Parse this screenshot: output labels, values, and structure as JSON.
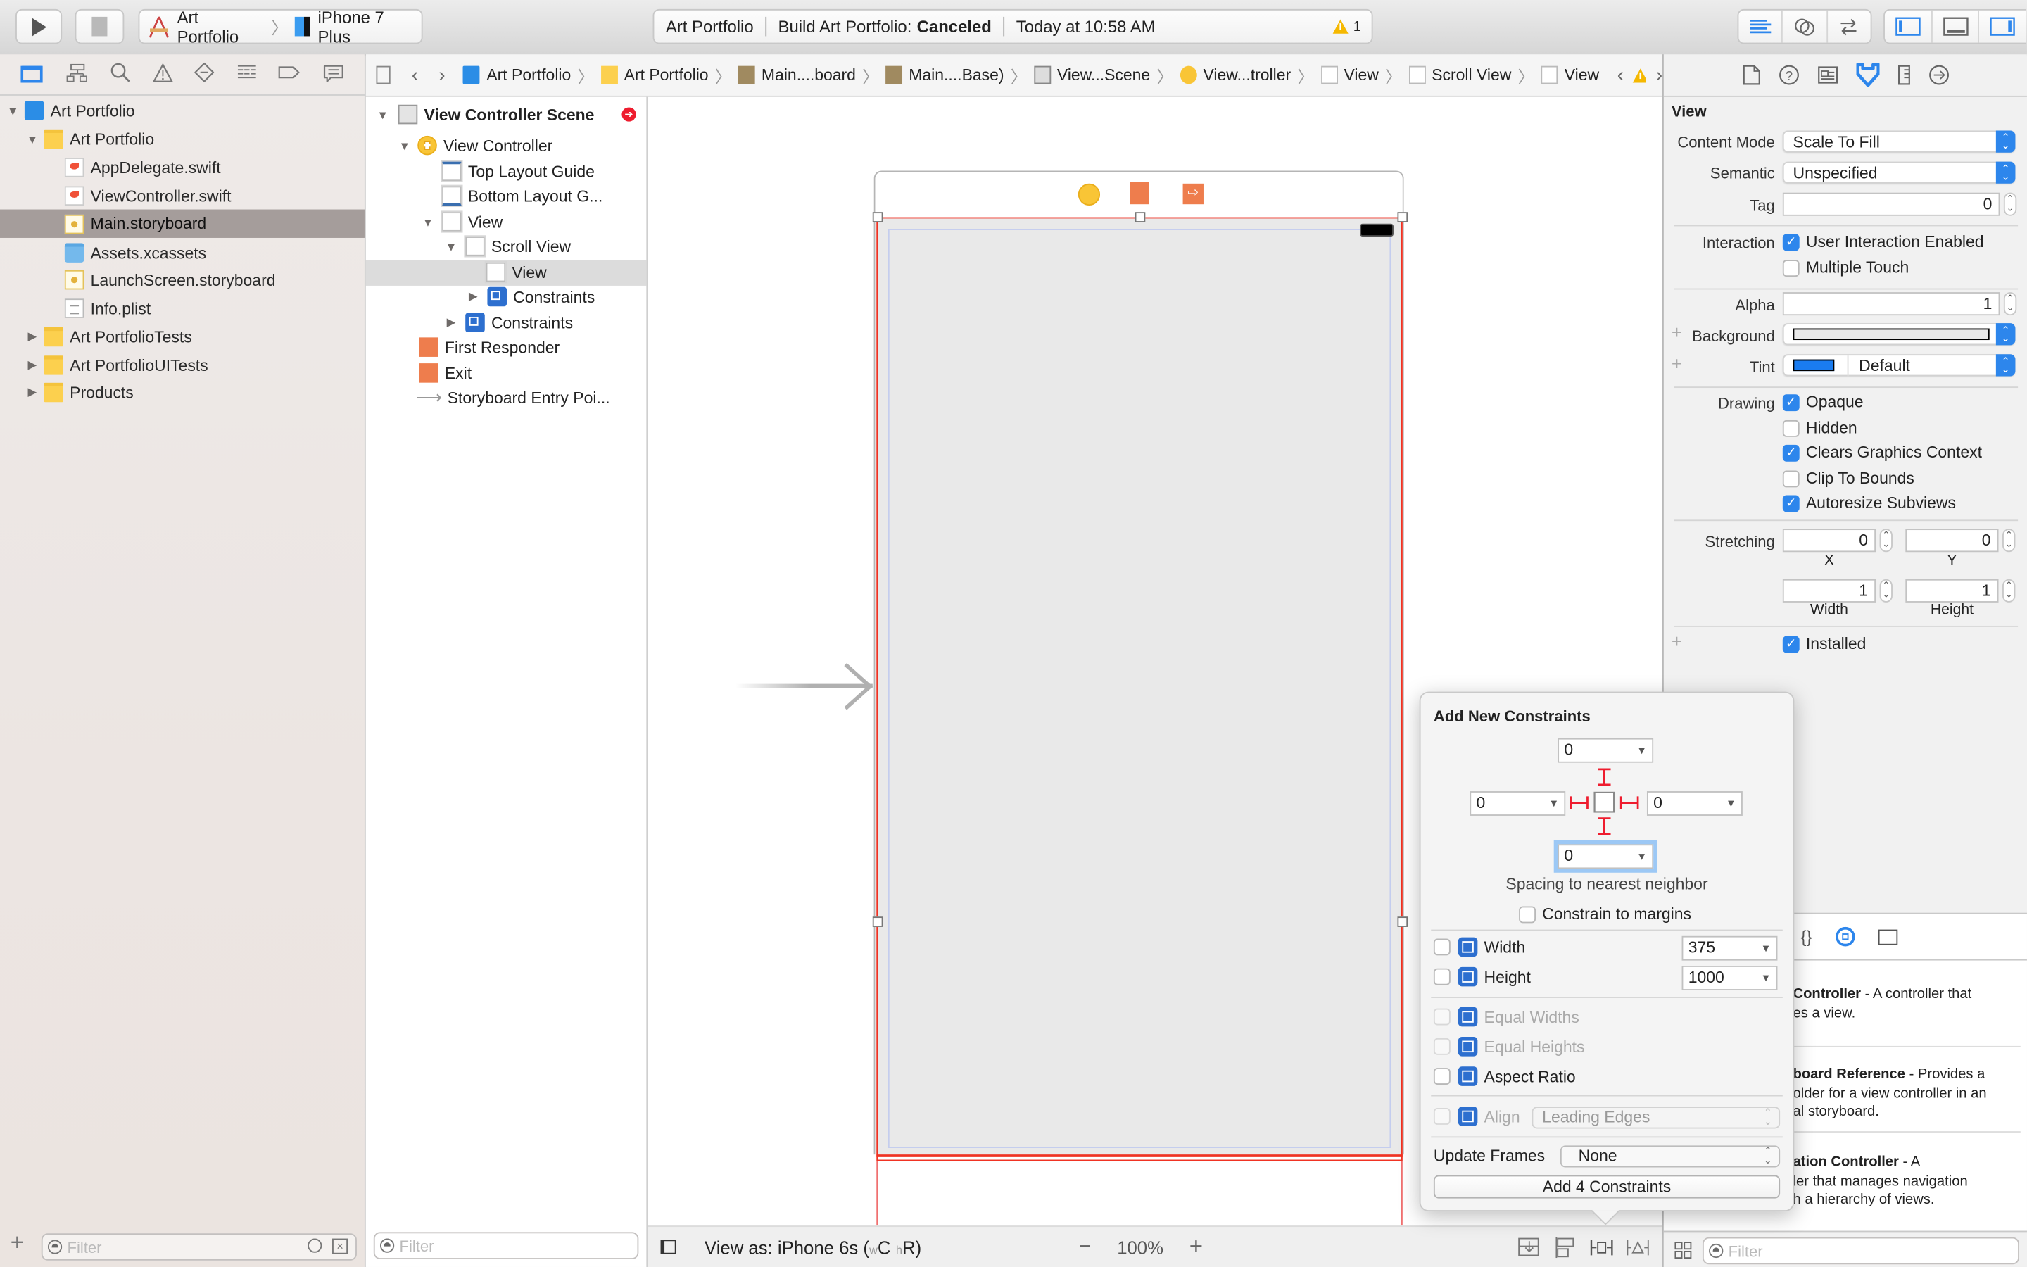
{
  "toolbar": {
    "scheme": "Art Portfolio",
    "device": "iPhone 7 Plus",
    "activity": {
      "project": "Art Portfolio",
      "status_prefix": "Build Art Portfolio:",
      "status": "Canceled",
      "time": "Today at 10:58 AM",
      "warning_count": "1"
    }
  },
  "navigator": {
    "items": [
      {
        "label": "Art Portfolio",
        "icon": "project-icon",
        "level": 0,
        "expanded": true
      },
      {
        "label": "Art Portfolio",
        "icon": "folder-icon",
        "level": 1,
        "expanded": true
      },
      {
        "label": "AppDelegate.swift",
        "icon": "swift-file-icon",
        "level": 2
      },
      {
        "label": "ViewController.swift",
        "icon": "swift-file-icon",
        "level": 2
      },
      {
        "label": "Main.storyboard",
        "icon": "storyboard-icon",
        "level": 2,
        "selected": true
      },
      {
        "label": "Assets.xcassets",
        "icon": "asset-catalog-icon",
        "level": 2
      },
      {
        "label": "LaunchScreen.storyboard",
        "icon": "storyboard-icon",
        "level": 2
      },
      {
        "label": "Info.plist",
        "icon": "plist-icon",
        "level": 2
      },
      {
        "label": "Art PortfolioTests",
        "icon": "folder-icon",
        "level": 1,
        "expanded": false
      },
      {
        "label": "Art PortfolioUITests",
        "icon": "folder-icon",
        "level": 1,
        "expanded": false
      },
      {
        "label": "Products",
        "icon": "folder-icon",
        "level": 1,
        "expanded": false
      }
    ],
    "filter_placeholder": "Filter"
  },
  "jumpbar": {
    "crumbs": [
      "Art Portfolio",
      "Art Portfolio",
      "Main....board",
      "Main....Base)",
      "View...Scene",
      "View...troller",
      "View",
      "Scroll View",
      "View"
    ]
  },
  "outline": {
    "items": [
      {
        "label": "View Controller Scene",
        "bold": true
      },
      {
        "label": "View Controller"
      },
      {
        "label": "Top Layout Guide"
      },
      {
        "label": "Bottom Layout G..."
      },
      {
        "label": "View"
      },
      {
        "label": "Scroll View"
      },
      {
        "label": "View",
        "selected": true
      },
      {
        "label": "Constraints"
      },
      {
        "label": "Constraints"
      },
      {
        "label": "First Responder"
      },
      {
        "label": "Exit"
      },
      {
        "label": "Storyboard Entry Poi..."
      }
    ],
    "filter_placeholder": "Filter"
  },
  "canvas_bar": {
    "view_as": "View as: iPhone 6s (",
    "w_label": "w",
    "w_class": "C",
    "h_label": "h",
    "h_class": "R",
    "close_paren": ")",
    "zoom": "100%",
    "minus": "−",
    "plus": "+"
  },
  "inspector": {
    "section_title": "View",
    "content_mode_label": "Content Mode",
    "content_mode": "Scale To Fill",
    "semantic_label": "Semantic",
    "semantic": "Unspecified",
    "tag_label": "Tag",
    "tag": "0",
    "interaction_label": "Interaction",
    "user_interaction_enabled": {
      "label": "User Interaction Enabled",
      "checked": true
    },
    "multiple_touch": {
      "label": "Multiple Touch",
      "checked": false
    },
    "alpha_label": "Alpha",
    "alpha": "1",
    "background_label": "Background",
    "tint_label": "Tint",
    "tint": "Default",
    "tint_color": "#1a7cf0",
    "drawing_label": "Drawing",
    "opaque": {
      "label": "Opaque",
      "checked": true
    },
    "hidden": {
      "label": "Hidden",
      "checked": false
    },
    "clears_graphics_context": {
      "label": "Clears Graphics Context",
      "checked": true
    },
    "clip_to_bounds": {
      "label": "Clip To Bounds",
      "checked": false
    },
    "autoresize_subviews": {
      "label": "Autoresize Subviews",
      "checked": true
    },
    "stretching_label": "Stretching",
    "stretch_x": "0",
    "stretch_y": "0",
    "stretch_width": "1",
    "stretch_height": "1",
    "x_label": "X",
    "y_label": "Y",
    "width_label": "Width",
    "height_label": "Height",
    "installed": {
      "label": "Installed",
      "checked": true
    }
  },
  "library": {
    "items": [
      {
        "title": "Controller",
        "desc_line1": " - A controller that",
        "desc_line2": "es a view.",
        "desc_line3": ""
      },
      {
        "title": "board Reference",
        "desc_line1": " - Provides a",
        "desc_line2": "older for a view controller in an",
        "desc_line3": "al storyboard."
      },
      {
        "title": "ation Controller",
        "desc_line1": " - A",
        "desc_line2": "ler that manages navigation",
        "desc_line3": "h a hierarchy of views."
      }
    ],
    "filter_placeholder": "Filter"
  },
  "popover": {
    "title": "Add New Constraints",
    "top": "0",
    "left": "0",
    "right": "0",
    "bottom": "0",
    "spacing_caption": "Spacing to nearest neighbor",
    "constrain_to_margins": {
      "label": "Constrain to margins",
      "checked": false
    },
    "width": {
      "label": "Width",
      "value": "375",
      "checked": false
    },
    "height": {
      "label": "Height",
      "value": "1000",
      "checked": false
    },
    "equal_widths": {
      "label": "Equal Widths",
      "enabled": false
    },
    "equal_heights": {
      "label": "Equal Heights",
      "enabled": false
    },
    "aspect_ratio": {
      "label": "Aspect Ratio",
      "checked": false
    },
    "align": {
      "label": "Align",
      "value": "Leading Edges",
      "enabled": false
    },
    "update_frames_label": "Update Frames",
    "update_frames": "None",
    "add_button": "Add 4 Constraints"
  },
  "colors": {
    "accent": "#2d86ec",
    "constraint_red": "#ee1c2e",
    "selection_nav": "#a59d9b"
  }
}
